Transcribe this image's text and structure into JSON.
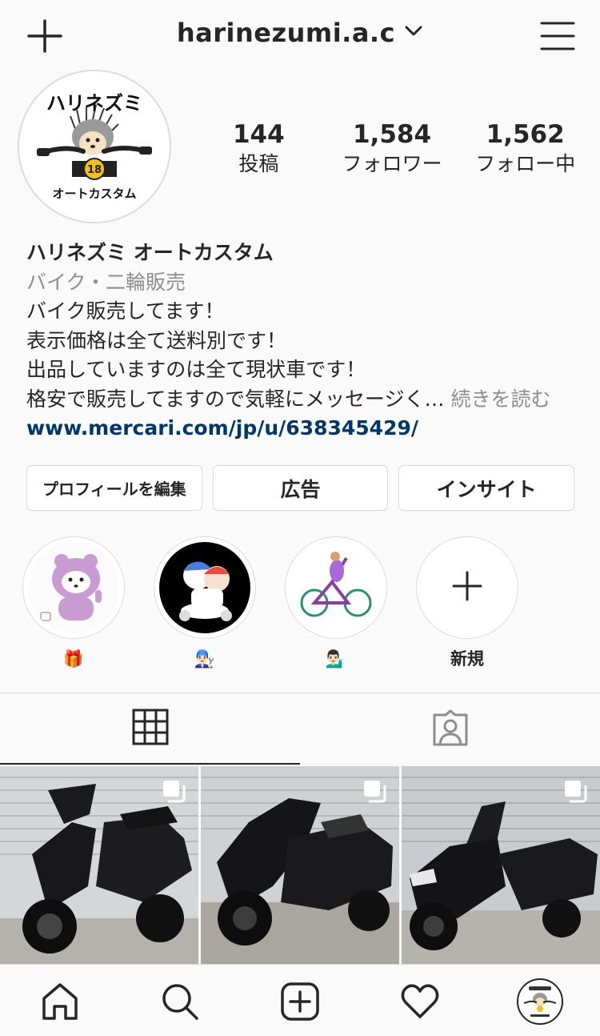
{
  "header": {
    "username": "harinezumi.a.c"
  },
  "profile": {
    "avatar_logo_top": "ハリネズミ",
    "avatar_logo_bottom": "オートカスタム",
    "stats": [
      {
        "value": "144",
        "label": "投稿"
      },
      {
        "value": "1,584",
        "label": "フォロワー"
      },
      {
        "value": "1,562",
        "label": "フォロー中"
      }
    ]
  },
  "bio": {
    "name": "ハリネズミ オートカスタム",
    "category": "バイク・二輪販売",
    "lines": [
      "バイク販売してます！",
      "表示価格は全て送料別です！",
      "出品していますのは全て現状車です！",
      "格安で販売してますので気軽にメッセージく…"
    ],
    "more": "続きを読む",
    "link": "www.mercari.com/jp/u/638345429/"
  },
  "actions": {
    "edit_profile": "プロフィールを編集",
    "promotions": "広告",
    "insights": "インサイト"
  },
  "highlights": [
    {
      "label": "🎁",
      "icon": "gift-emoji"
    },
    {
      "label": "👨🏻‍🔧",
      "icon": "mechanic-emoji"
    },
    {
      "label": "💁🏻‍♂️",
      "icon": "tipping-hand-emoji"
    },
    {
      "label": "新規",
      "icon": "plus-icon"
    }
  ],
  "tabs": [
    {
      "name": "grid",
      "icon": "grid-icon",
      "active": true
    },
    {
      "name": "tagged",
      "icon": "tagged-person-icon",
      "active": false
    }
  ],
  "posts": [
    {
      "subject": "black scooter",
      "multi": true
    },
    {
      "subject": "black big scooter",
      "multi": true
    },
    {
      "subject": "black big scooter",
      "multi": true
    }
  ],
  "bottom_nav": [
    "home-icon",
    "search-icon",
    "new-post-icon",
    "activity-heart-icon",
    "profile-avatar"
  ],
  "colors": {
    "link": "#00376b",
    "muted": "#8e8e8e",
    "border": "#dbdbdb",
    "text": "#262626"
  }
}
